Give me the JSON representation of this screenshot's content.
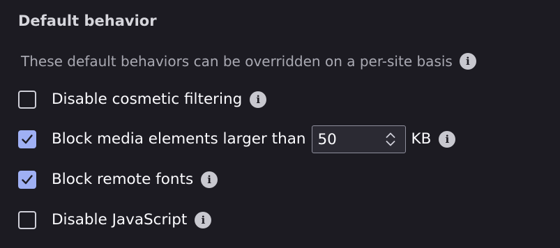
{
  "section": {
    "title": "Default behavior",
    "description": "These default behaviors can be overridden on a per-site basis",
    "info_icon": "info-icon"
  },
  "options": [
    {
      "label": "Disable cosmetic filtering",
      "checked": false
    },
    {
      "label": "Block media elements larger than",
      "checked": true,
      "value": "50",
      "unit": "KB"
    },
    {
      "label": "Block remote fonts",
      "checked": true
    },
    {
      "label": "Disable JavaScript",
      "checked": false
    }
  ],
  "colors": {
    "background": "#1c1b22",
    "checkbox_accent": "#9fb0f4",
    "text": "#fbfbfe",
    "muted_text": "#a9a9b2"
  }
}
